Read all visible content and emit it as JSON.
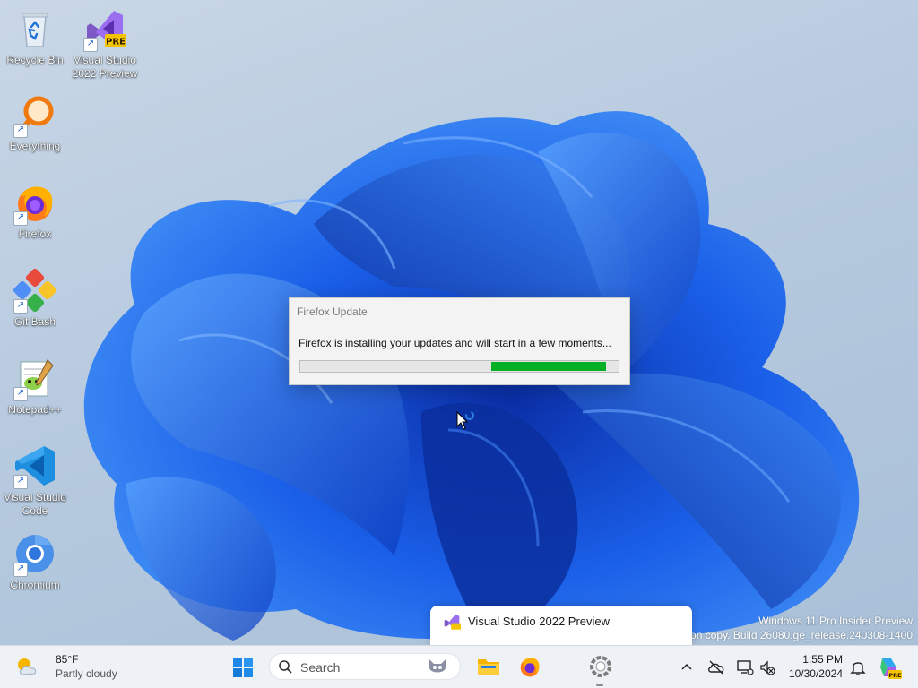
{
  "desktop": {
    "icons": [
      {
        "id": "recycle-bin",
        "label": "Recycle Bin"
      },
      {
        "id": "visual-studio-2022-preview",
        "label": "Visual Studio\n2022 Preview",
        "badge": "PRE"
      },
      {
        "id": "everything",
        "label": "Everything"
      },
      {
        "id": "firefox",
        "label": "Firefox"
      },
      {
        "id": "git-bash",
        "label": "Git Bash"
      },
      {
        "id": "notepad-plus-plus",
        "label": "Notepad++"
      },
      {
        "id": "visual-studio-code",
        "label": "Visual Studio\nCode"
      },
      {
        "id": "chromium",
        "label": "Chromium"
      }
    ]
  },
  "update_dialog": {
    "title": "Firefox Update",
    "message": "Firefox is installing your updates and will start in a few moments...",
    "progress_segment": {
      "start": 0.6,
      "end": 0.96
    }
  },
  "watermark": {
    "line1": "Windows 11 Pro Insider Preview",
    "line2": "ation copy. Build 26080.ge_release.240308-1400"
  },
  "taskbar_preview": {
    "title": "Visual Studio 2022 Preview"
  },
  "taskbar": {
    "weather": {
      "temperature": "85°F",
      "condition": "Partly cloudy",
      "icon": "partly-cloudy-icon"
    },
    "search_placeholder": "Search",
    "pinned_apps": [
      "start-icon",
      "file-explorer-icon",
      "firefox-icon",
      "visual-studio-installer-icon"
    ],
    "tray": {
      "time": "1:55 PM",
      "date": "10/30/2024",
      "icons": [
        "chevron-up-icon",
        "onedrive-icon",
        "network-icon",
        "volume-muted-icon",
        "notifications-icon",
        "copilot-icon"
      ]
    }
  },
  "colors": {
    "progress_fill": "#06b025",
    "accent": "#0067c0",
    "wallpaper_blue": "#1565e0"
  }
}
